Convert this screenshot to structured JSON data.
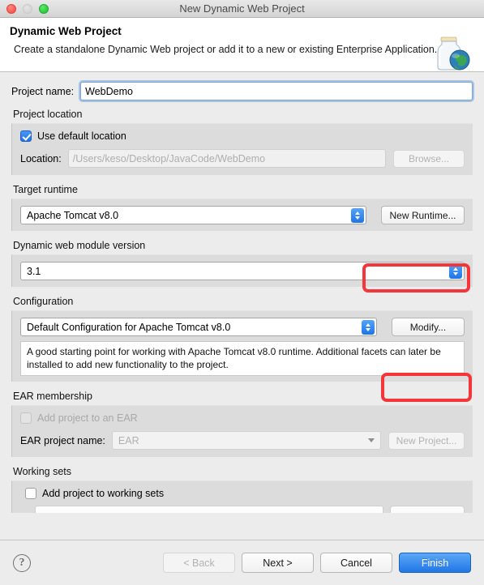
{
  "window": {
    "title": "New Dynamic Web Project",
    "traffic_lights": [
      "close",
      "minimize-disabled",
      "zoom"
    ]
  },
  "header": {
    "title": "Dynamic Web Project",
    "description": "Create a standalone Dynamic Web project or add it to a new or existing Enterprise Application.",
    "icon": "jar-globe-icon"
  },
  "project_name": {
    "label": "Project name:",
    "value": "WebDemo",
    "placeholder": ""
  },
  "project_location": {
    "group_label": "Project location",
    "use_default_label": "Use default location",
    "use_default_checked": true,
    "location_label": "Location:",
    "location_value": "/Users/keso/Desktop/JavaCode/WebDemo",
    "browse_label": "Browse...",
    "browse_enabled": false
  },
  "target_runtime": {
    "group_label": "Target runtime",
    "selected": "Apache Tomcat v8.0",
    "new_runtime_label": "New Runtime...",
    "highlighted": true
  },
  "module_version": {
    "group_label": "Dynamic web module version",
    "selected": "3.1"
  },
  "configuration": {
    "group_label": "Configuration",
    "selected": "Default Configuration for Apache Tomcat v8.0",
    "modify_label": "Modify...",
    "highlighted": true,
    "description": "A good starting point for working with Apache Tomcat v8.0 runtime. Additional facets can later be installed to add new functionality to the project."
  },
  "ear_membership": {
    "group_label": "EAR membership",
    "add_to_ear_label": "Add project to an EAR",
    "add_to_ear_checked": false,
    "add_to_ear_enabled": false,
    "ear_project_label": "EAR project name:",
    "ear_project_value": "EAR",
    "ear_project_enabled": false,
    "new_project_label": "New Project...",
    "new_project_enabled": false
  },
  "working_sets": {
    "group_label": "Working sets",
    "add_to_working_sets_label": "Add project to working sets",
    "add_to_working_sets_checked": false
  },
  "footer": {
    "help_label": "?",
    "back_label": "< Back",
    "back_enabled": false,
    "next_label": "Next >",
    "cancel_label": "Cancel",
    "finish_label": "Finish"
  },
  "colors": {
    "highlight": "#f4363a",
    "accent_blue": "#2176e8",
    "panel": "#dcdcdc",
    "window_bg": "#ececec"
  }
}
